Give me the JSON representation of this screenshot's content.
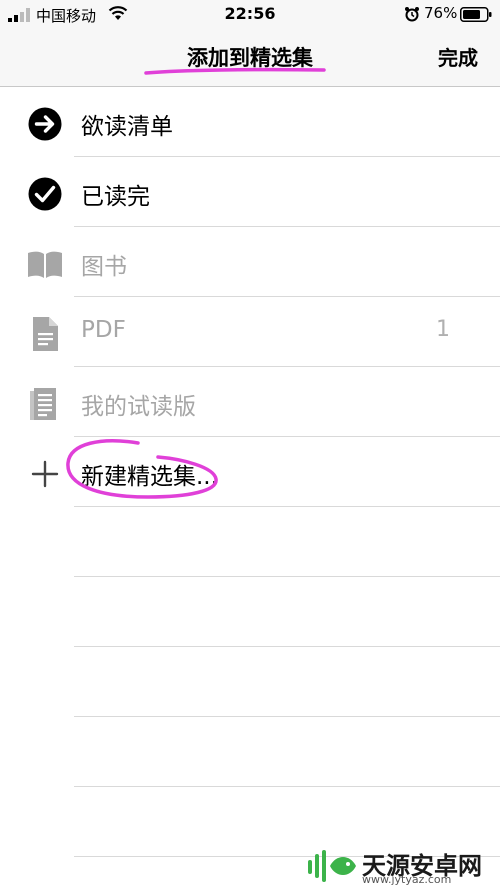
{
  "status_bar": {
    "carrier": "中国移动",
    "time": "22:56",
    "battery": "76%"
  },
  "nav": {
    "title": "添加到精选集",
    "done_label": "完成"
  },
  "collections": [
    {
      "label": "欲读清单",
      "icon": "arrow-circle-icon",
      "enabled": true,
      "count": ""
    },
    {
      "label": "已读完",
      "icon": "checkmark-circle-icon",
      "enabled": true,
      "count": ""
    },
    {
      "label": "图书",
      "icon": "book-icon",
      "enabled": false,
      "count": ""
    },
    {
      "label": "PDF",
      "icon": "document-icon",
      "enabled": false,
      "count": "1"
    },
    {
      "label": "我的试读版",
      "icon": "sample-icon",
      "enabled": false,
      "count": ""
    },
    {
      "label": "新建精选集...",
      "icon": "plus-icon",
      "enabled": true,
      "count": ""
    }
  ],
  "colors": {
    "annotation": "#e040d8",
    "disabled": "#a6a6a6",
    "separator": "#d9d9d9",
    "watermark_green": "#3cb34a"
  },
  "watermark": {
    "name": "天源安卓网",
    "url": "www.jytyaz.com"
  }
}
